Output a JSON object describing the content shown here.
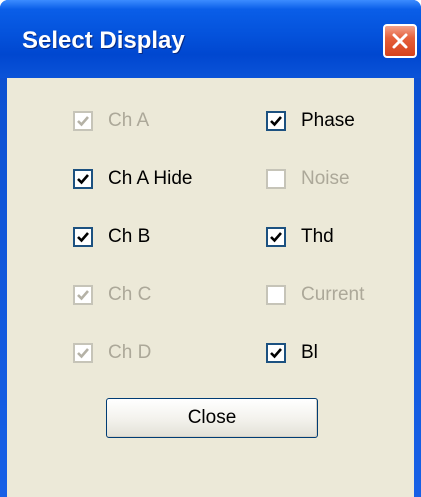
{
  "window": {
    "title": "Select Display"
  },
  "checkboxes": {
    "ch_a": {
      "label": "Ch A",
      "checked": true,
      "enabled": false
    },
    "ch_a_hide": {
      "label": "Ch A Hide",
      "checked": true,
      "enabled": true
    },
    "ch_b": {
      "label": "Ch B",
      "checked": true,
      "enabled": true
    },
    "ch_c": {
      "label": "Ch C",
      "checked": true,
      "enabled": false
    },
    "ch_d": {
      "label": "Ch D",
      "checked": true,
      "enabled": false
    },
    "phase": {
      "label": "Phase",
      "checked": true,
      "enabled": true
    },
    "noise": {
      "label": "Noise",
      "checked": false,
      "enabled": false
    },
    "thd": {
      "label": "Thd",
      "checked": true,
      "enabled": true
    },
    "current": {
      "label": "Current",
      "checked": false,
      "enabled": false
    },
    "bl": {
      "label": "Bl",
      "checked": true,
      "enabled": true
    }
  },
  "buttons": {
    "close_label": "Close"
  },
  "icons": {
    "title_close": "close-icon",
    "check": "checkmark-icon"
  },
  "colors": {
    "titlebar": "#0452db",
    "close_button": "#d6421c",
    "client_background": "#ece9d8",
    "disabled_text": "#aca899"
  }
}
